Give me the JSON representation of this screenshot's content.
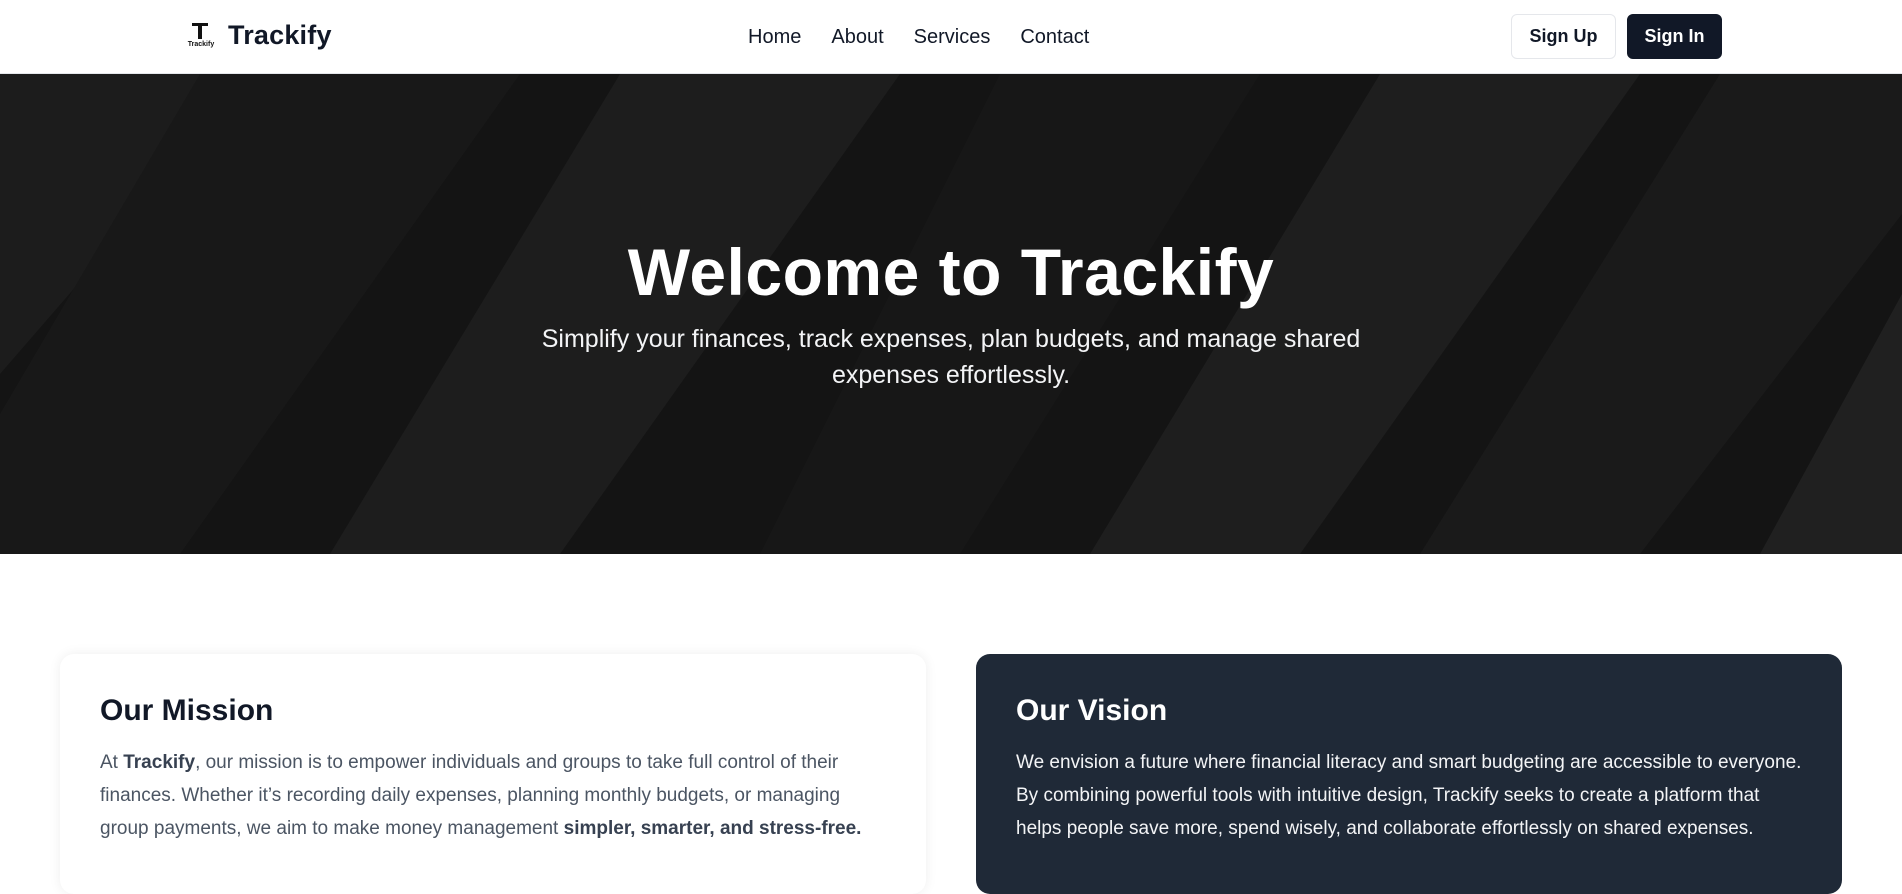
{
  "brand": {
    "logo_text": "Trackify",
    "logo_small": "Trackify"
  },
  "nav": {
    "items": [
      "Home",
      "About",
      "Services",
      "Contact"
    ]
  },
  "buttons": {
    "sign_up": "Sign Up",
    "sign_in": "Sign In"
  },
  "hero": {
    "title": "Welcome to Trackify",
    "subtitle": "Simplify your finances, track expenses, plan budgets, and manage shared expenses effortlessly."
  },
  "mission": {
    "heading": "Our Mission",
    "text_1": "At ",
    "brand_bold": "Trackify",
    "text_2": ", our mission is to empower individuals and groups to take full control of their finances. Whether it’s recording daily expenses, planning monthly budgets, or managing group payments, we aim to make money management ",
    "bold_end": "simpler, smarter, and stress-free."
  },
  "vision": {
    "heading": "Our Vision",
    "text": "We envision a future where financial literacy and smart budgeting are accessible to everyone. By combining powerful tools with intuitive design, Trackify seeks to create a platform that helps people save more, spend wisely, and collaborate effortlessly on shared expenses."
  },
  "colors": {
    "dark": "#111827",
    "card_dark": "#1f2937",
    "hero_bg": "#141414"
  }
}
